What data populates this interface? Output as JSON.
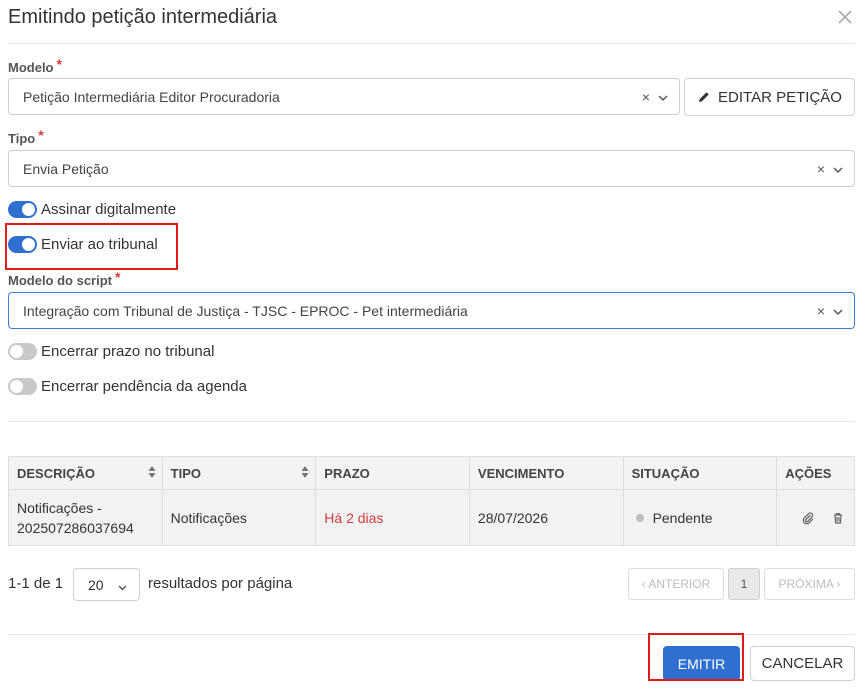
{
  "dialog": {
    "title": "Emitindo petição intermediária",
    "close_icon": "close-icon"
  },
  "form": {
    "modelo": {
      "label": "Modelo",
      "required": "*",
      "value": "Petição Intermediária Editor Procuradoria",
      "clear": "×"
    },
    "edit_button": {
      "label": "EDITAR PETIÇÃO",
      "icon": "pencil-icon"
    },
    "tipo": {
      "label": "Tipo",
      "required": "*",
      "value": "Envia Petição",
      "clear": "×"
    },
    "toggles_top": [
      {
        "label": "Assinar digitalmente",
        "on": true
      },
      {
        "label": "Enviar ao tribunal",
        "on": true
      }
    ],
    "modelo_script": {
      "label": "Modelo do script",
      "required": "*",
      "value": "Integração com Tribunal de Justiça - TJSC - EPROC - Pet intermediária",
      "clear": "×"
    },
    "toggles_bottom": [
      {
        "label": "Encerrar prazo no tribunal",
        "on": false
      },
      {
        "label": "Encerrar pendência da agenda",
        "on": false
      }
    ]
  },
  "table": {
    "columns": [
      "DESCRIÇÃO",
      "TIPO",
      "PRAZO",
      "VENCIMENTO",
      "SITUAÇÃO",
      "AÇÕES"
    ],
    "rows": [
      {
        "descricao_line1": "Notificações -",
        "descricao_line2": "202507286037694",
        "tipo": "Notificações",
        "prazo": "Há 2 dias",
        "vencimento": "28/07/2026",
        "situacao": "Pendente",
        "actions": [
          "paperclip-icon",
          "trash-icon"
        ]
      }
    ]
  },
  "pagination": {
    "range": "1-1 de 1",
    "per_page": "20",
    "per_page_label": "resultados por página",
    "prev": "‹ ANTERIOR",
    "current_page": "1",
    "next": "PRÓXIMA ›"
  },
  "footer": {
    "emitir": "EMITIR",
    "cancelar": "CANCELAR"
  },
  "colors": {
    "primary": "#2f6fcf",
    "required": "#d23b3b",
    "highlight_box": "#e01b1b",
    "toggle_off": "#c9c9c9"
  }
}
